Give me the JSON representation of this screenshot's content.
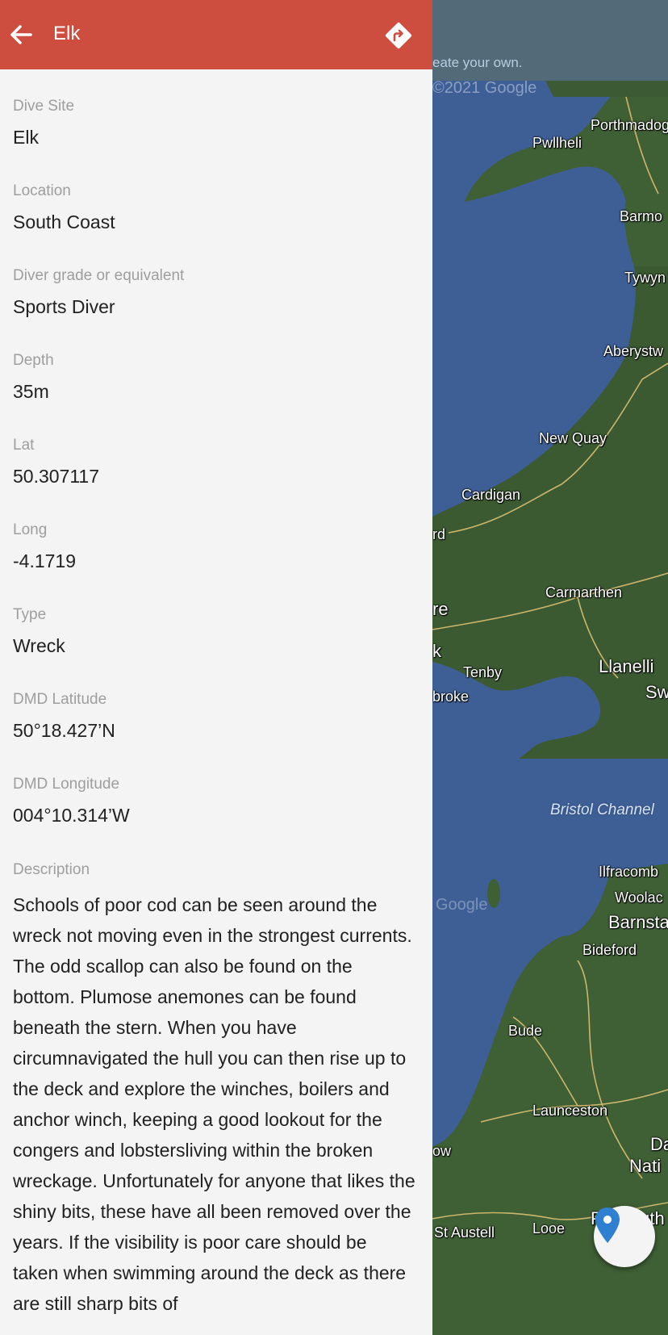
{
  "header": {
    "title": "Elk",
    "back_icon": "arrow-left-icon",
    "directions_icon": "directions-icon",
    "color": "#cd4d3f"
  },
  "fields": [
    {
      "label": "Dive Site",
      "value": "Elk"
    },
    {
      "label": "Location",
      "value": "South Coast"
    },
    {
      "label": "Diver grade or equivalent",
      "value": "Sports Diver"
    },
    {
      "label": "Depth",
      "value": "35m"
    },
    {
      "label": "Lat",
      "value": "50.307117"
    },
    {
      "label": "Long",
      "value": "-4.1719"
    },
    {
      "label": "Type",
      "value": "Wreck"
    },
    {
      "label": "DMD Latitude",
      "value": "50°18.427’N"
    },
    {
      "label": "DMD Longitude",
      "value": "004°10.314’W"
    }
  ],
  "description": {
    "label": "Description",
    "value": "Schools of poor cod can be seen around the wreck not moving even in the strongest currents. The odd scallop can also be found on the bottom. Plumose anemones can be found beneath the stern. When you have circumnavigated the hull you can then rise up to the deck and explore the winches, boilers and anchor winch, keeping a good lookout for the congers and lobstersliving within the broken wreckage. Unfortunately for anyone that likes the shiny bits, these have all been removed over the years. If the visibility is poor care should be taken when swimming around the deck as there are still sharp bits of"
  },
  "map": {
    "top_hint": "eate your own.",
    "watermark": "©2021 Google",
    "watermark2": "Google",
    "sea_label": "Bristol Channel",
    "places": {
      "porthmadog": "Porthmadog",
      "pwllheli": "Pwllheli",
      "barmouth": "Barmo",
      "tywyn": "Tywyn",
      "aberystwyth": "Aberystw",
      "new_quay": "New Quay",
      "cardigan": "Cardigan",
      "rd": "rd",
      "carmarthen": "Carmarthen",
      "re": "re",
      "k": "k",
      "tenby": "Tenby",
      "llanelli": "Llanelli",
      "sw": "Sw",
      "broke": "broke",
      "ilfracombe": "Ilfracomb",
      "woolacombe": "Woolac",
      "barnstaple": "Barnsta",
      "bideford": "Bideford",
      "bude": "Bude",
      "launceston": "Launceston",
      "dartmoor_1": "Da",
      "dartmoor_2": "Nati",
      "ow": "ow",
      "st_austell": "St Austell",
      "looe": "Looe",
      "plymouth": "Plymouth"
    },
    "location_icon": "map-pin-icon",
    "land_color": "#3f5f35",
    "sea_color": "#3e5f96"
  }
}
